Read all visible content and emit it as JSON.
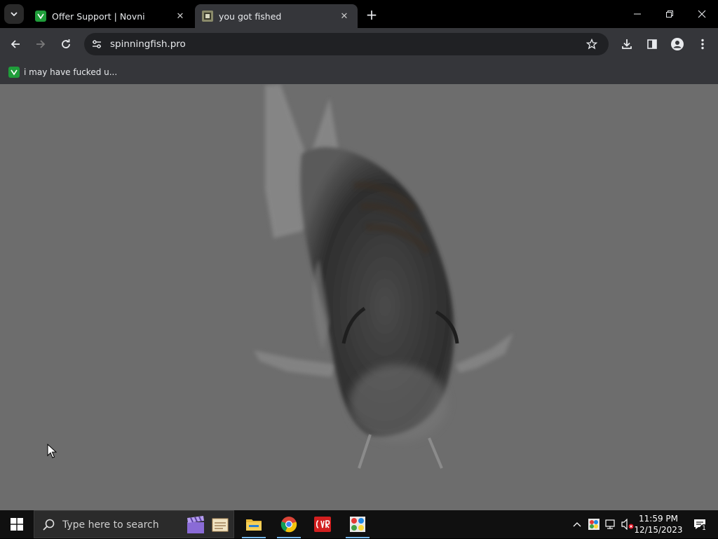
{
  "browser": {
    "tabs": [
      {
        "title": "Offer Support | Novni",
        "active": false,
        "favicon": "novni-icon"
      },
      {
        "title": "you got fished",
        "active": true,
        "favicon": "fish-thumbnail-icon"
      }
    ],
    "tab_close_glyph": "✕",
    "new_tab_glyph": "+",
    "address": {
      "url": "spinningfish.pro"
    },
    "bookmarks": [
      {
        "label": "i may have fucked u...",
        "favicon": "novni-icon"
      }
    ]
  },
  "colors": {
    "page_background": "#6d6d6d",
    "active_tab": "#35363a",
    "omnibox": "#202124",
    "novni_green": "#1f9d3a",
    "taskbar": "#101010",
    "taskbar_underline": "#76b9ed"
  },
  "taskbar": {
    "search_placeholder": "Type here to search",
    "apps": [
      {
        "name": "file-explorer-icon",
        "active": true
      },
      {
        "name": "chrome-icon",
        "active": true
      },
      {
        "name": "cvr-app-icon",
        "active": false
      },
      {
        "name": "paint-app-icon",
        "active": true
      }
    ],
    "clock": {
      "time": "11:59 PM",
      "date": "12/15/2023"
    },
    "notification_count": "1"
  }
}
